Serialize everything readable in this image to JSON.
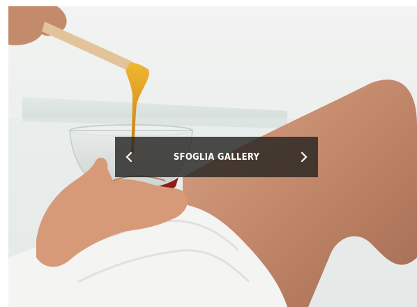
{
  "hero": {
    "image_subject": "waxing-spa-photo",
    "gallery_label": "SFOGLIA GALLERY",
    "prev_icon": "chevron-left-icon",
    "next_icon": "chevron-right-icon"
  },
  "colors": {
    "overlay": "#262422",
    "label": "#ffffff",
    "wax": "#e0a020",
    "skin": "#c98e6e",
    "robe": "#f4f4f2"
  }
}
